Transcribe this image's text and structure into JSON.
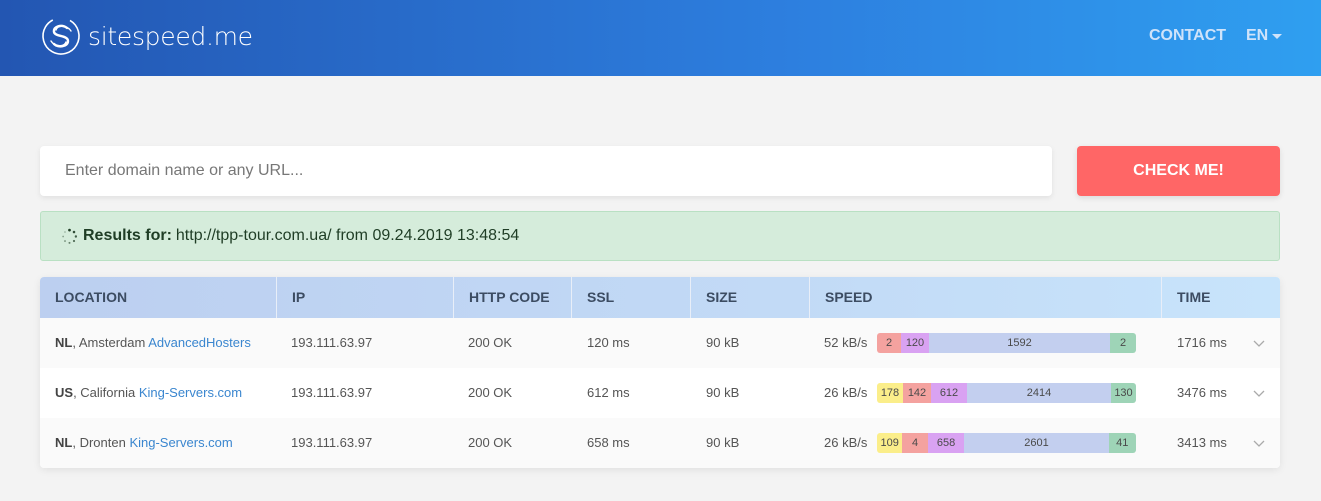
{
  "header": {
    "logo_text": "sitespeed.me",
    "nav": {
      "contact": "CONTACT",
      "lang": "EN"
    }
  },
  "search": {
    "placeholder": "Enter domain name or any URL...",
    "value": "",
    "button": "CHECK ME!"
  },
  "results": {
    "label": "Results for:",
    "text": "http://tpp-tour.com.ua/ from 09.24.2019 13:48:54"
  },
  "table": {
    "columns": [
      "LOCATION",
      "IP",
      "HTTP CODE",
      "SSL",
      "SIZE",
      "SPEED",
      "TIME"
    ],
    "rows": [
      {
        "country": "NL",
        "city": ", Amsterdam ",
        "host": "AdvancedHosters",
        "ip": "193.111.63.97",
        "http": "200 OK",
        "ssl": "120 ms",
        "size": "90 kB",
        "speed": "52 kB/s",
        "segments": [
          {
            "value": "2",
            "color": "#f4a29f"
          },
          {
            "value": "120",
            "color": "#d9a2f2"
          },
          {
            "value": "1592",
            "color": "#c3cfef"
          },
          {
            "value": "2",
            "color": "#9ed4b7"
          }
        ],
        "time": "1716 ms"
      },
      {
        "country": "US",
        "city": ", California ",
        "host": "King-Servers.com",
        "ip": "193.111.63.97",
        "http": "200 OK",
        "ssl": "612 ms",
        "size": "90 kB",
        "speed": "26 kB/s",
        "segments": [
          {
            "value": "178",
            "color": "#fbee8a"
          },
          {
            "value": "142",
            "color": "#f4a29f"
          },
          {
            "value": "612",
            "color": "#d9a2f2"
          },
          {
            "value": "2414",
            "color": "#c3cfef"
          },
          {
            "value": "130",
            "color": "#9ed4b7"
          }
        ],
        "time": "3476 ms"
      },
      {
        "country": "NL",
        "city": ", Dronten ",
        "host": "King-Servers.com",
        "ip": "193.111.63.97",
        "http": "200 OK",
        "ssl": "658 ms",
        "size": "90 kB",
        "speed": "26 kB/s",
        "segments": [
          {
            "value": "109",
            "color": "#fbee8a"
          },
          {
            "value": "4",
            "color": "#f4a29f"
          },
          {
            "value": "658",
            "color": "#d9a2f2"
          },
          {
            "value": "2601",
            "color": "#c3cfef"
          },
          {
            "value": "41",
            "color": "#9ed4b7"
          }
        ],
        "time": "3413 ms"
      }
    ]
  }
}
